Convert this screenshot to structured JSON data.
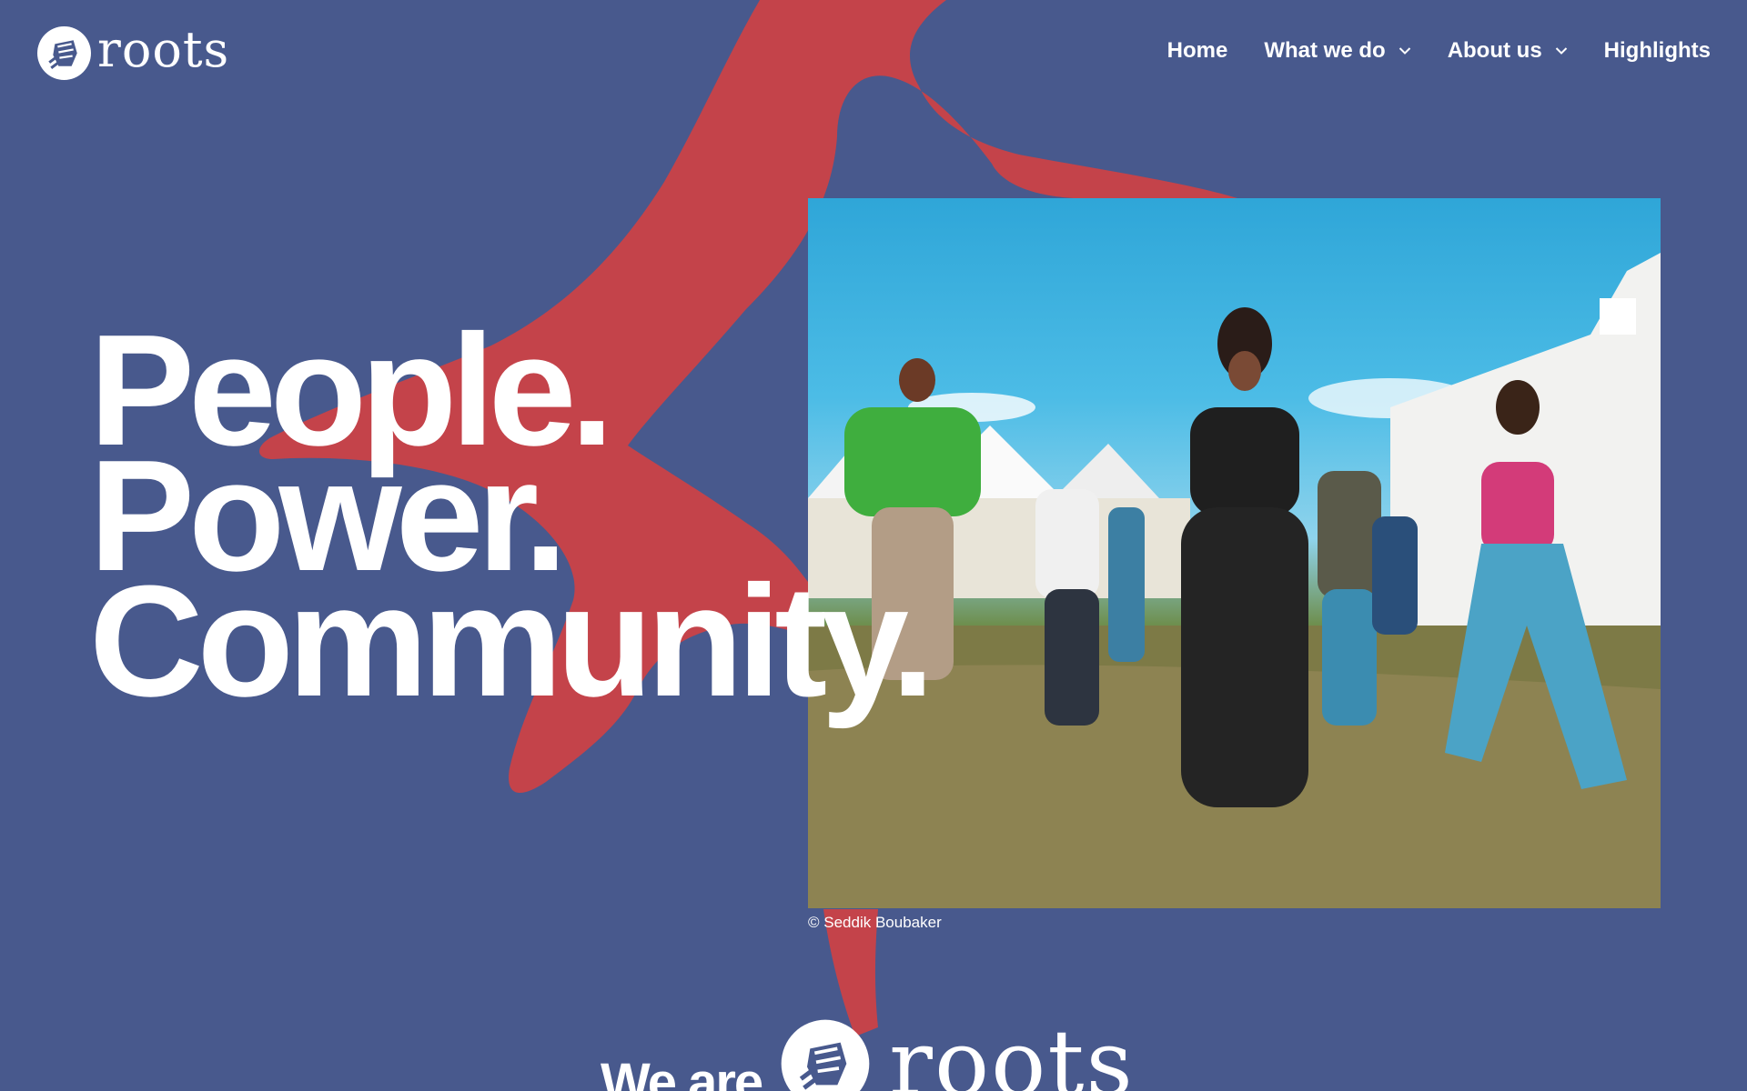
{
  "brand": {
    "name": "roots"
  },
  "nav": {
    "home": "Home",
    "what_we_do": "What we do",
    "about_us": "About us",
    "highlights": "Highlights"
  },
  "hero": {
    "line1": "People.",
    "line2": "Power.",
    "line3": "Community.",
    "photo_credit": "© Seddik Boubaker"
  },
  "strap": {
    "prefix": "We are",
    "brand": "roots"
  },
  "colors": {
    "background": "#48598d",
    "accent": "#c4434a",
    "text": "#ffffff"
  },
  "icons": {
    "logo": "fist-roots-logo-icon",
    "dropdown": "chevron-down-icon"
  }
}
